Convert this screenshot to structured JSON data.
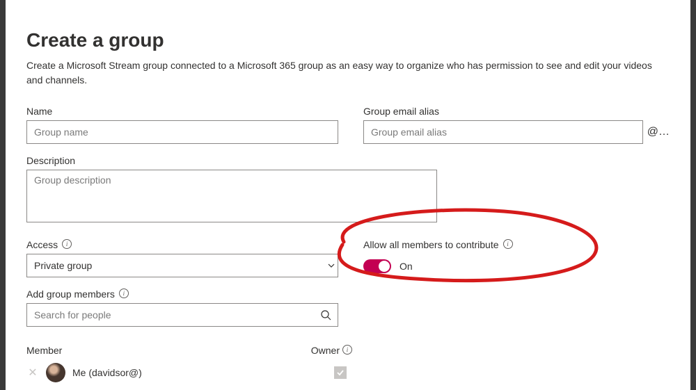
{
  "header": {
    "title": "Create a group",
    "description": "Create a Microsoft Stream group connected to a Microsoft 365 group as an easy way to organize who has permission to see and edit your videos and channels."
  },
  "fields": {
    "name": {
      "label": "Name",
      "placeholder": "Group name"
    },
    "email": {
      "label": "Group email alias",
      "placeholder": "Group email alias",
      "suffix": "@…"
    },
    "description": {
      "label": "Description",
      "placeholder": "Group description"
    },
    "access": {
      "label": "Access",
      "selected": "Private group"
    },
    "allow_contribute": {
      "label": "Allow all members to contribute",
      "state_label": "On",
      "on": true
    },
    "add_members": {
      "label": "Add group members",
      "placeholder": "Search for people"
    }
  },
  "members": {
    "header_member": "Member",
    "header_owner": "Owner",
    "rows": [
      {
        "display": "Me (davidsor@)",
        "is_owner": true
      }
    ]
  },
  "colors": {
    "accent": "#c30052",
    "annotation": "#d51b1b"
  }
}
